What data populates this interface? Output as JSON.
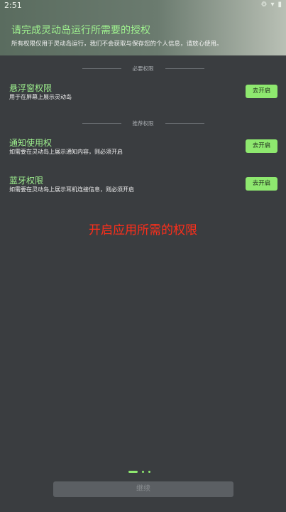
{
  "status_bar": {
    "time": "2:51",
    "icons": [
      "gear-icon",
      "wifi-icon",
      "battery-icon"
    ]
  },
  "header": {
    "title": "请完成灵动岛运行所需要的授权",
    "subtitle": "所有权限仅用于灵动岛运行，我们不会获取与保存您的个人信息，请放心使用。"
  },
  "sections": {
    "required": "必要权限",
    "recommended": "推荐权限"
  },
  "permissions": [
    {
      "title": "悬浮窗权限",
      "desc": "用于在屏幕上展示灵动岛",
      "button": "去开启"
    },
    {
      "title": "通知使用权",
      "desc": "如需要在灵动岛上展示通知内容，则必须开启",
      "button": "去开启"
    },
    {
      "title": "蓝牙权限",
      "desc": "如需要在灵动岛上展示耳机连接信息，则必须开启",
      "button": "去开启"
    }
  ],
  "hint_text": "开启应用所需的权限",
  "pager": {
    "count": 3,
    "active": 0
  },
  "continue_label": "继续",
  "colors": {
    "accent": "#8ee86f",
    "background": "#3a3d40",
    "hint": "#ff2e1a"
  }
}
